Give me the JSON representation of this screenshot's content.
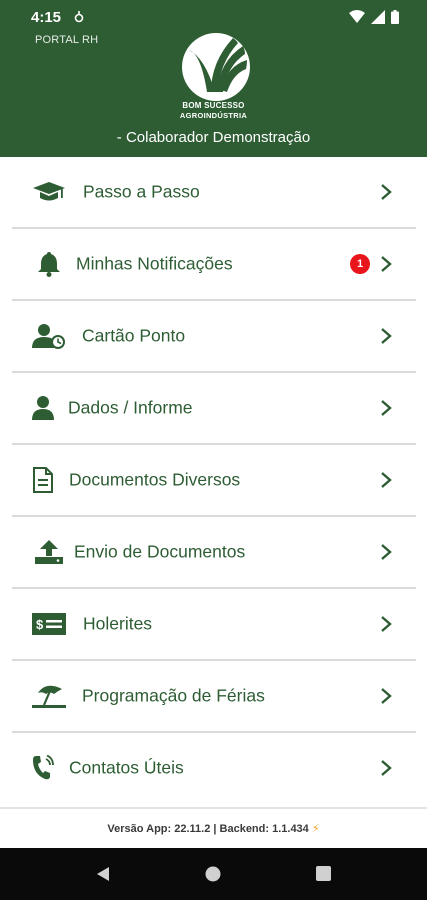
{
  "status_bar": {
    "time": "4:15"
  },
  "header": {
    "app_title": "PORTAL RH",
    "logo_line1": "BOM SUCESSO",
    "logo_line2": "AGROINDÚSTRIA",
    "user_name": "- Colaborador Demonstração",
    "background": "#2e5d34"
  },
  "menu": {
    "items": [
      {
        "label": "Passo a Passo",
        "icon": "graduation-cap-icon"
      },
      {
        "label": "Minhas Notificações",
        "icon": "bell-icon",
        "badge": "1"
      },
      {
        "label": "Cartão Ponto",
        "icon": "user-clock-icon"
      },
      {
        "label": "Dados / Informe",
        "icon": "user-icon"
      },
      {
        "label": "Documentos Diversos",
        "icon": "document-icon"
      },
      {
        "label": "Envio de Documentos",
        "icon": "upload-icon"
      },
      {
        "label": "Holerites",
        "icon": "money-check-icon"
      },
      {
        "label": "Programação de Férias",
        "icon": "umbrella-beach-icon"
      },
      {
        "label": "Contatos Úteis",
        "icon": "phone-icon"
      }
    ]
  },
  "footer": {
    "version": "Versão App: 22.11.2 | Backend: 1.1.434"
  },
  "colors": {
    "accent": "#2e5d34",
    "badge": "#e8151c"
  }
}
